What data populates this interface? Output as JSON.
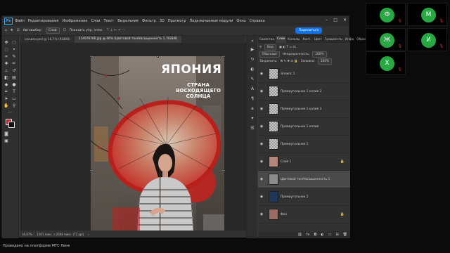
{
  "menubar": {
    "logo": "Ps",
    "items": [
      "Файл",
      "Редактирование",
      "Изображение",
      "Слои",
      "Текст",
      "Выделение",
      "Фильтр",
      "3D",
      "Просмотр",
      "Подключаемые модули",
      "Окно",
      "Справка"
    ]
  },
  "options": {
    "autoselect": "Автовыбор:",
    "layer": "Слой",
    "transform": "Показать упр. элем.",
    "share": "Поделиться"
  },
  "doc": {
    "tab1": "омники.psd @ 16,7% (RGB/8)",
    "tab2": "214970766.jpg @ 46% (Цветовой тон/Насыщенность 1, RGB/8)"
  },
  "artwork": {
    "title": "ЯПОНИЯ",
    "sub1": "СТРАНА",
    "sub2": "ВОСХОДЯЩЕГО",
    "sub3": "СОЛНЦА"
  },
  "status": {
    "zoom": "16,67%",
    "size": "1201 пикс. х 2048 пикс. (72 ppi)"
  },
  "panel": {
    "tabs": [
      "Свойства",
      "Слои",
      "Каналы",
      "Конт.",
      "Цвет",
      "Градиенты",
      "Инфо",
      "Образцы"
    ],
    "active_tab": "Слои",
    "kind": "Вид",
    "blend": "Обычные",
    "opacity_label": "Непрозрачность:",
    "opacity": "100%",
    "lock_label": "Закрепить:",
    "fill_label": "Заливка:",
    "fill": "100%",
    "layers": [
      {
        "name": "Эллипс 1"
      },
      {
        "name": "Прямоугольник 1 копия 2"
      },
      {
        "name": "Прямоугольник 1 копия 3"
      },
      {
        "name": "Прямоугольник 1 копия"
      },
      {
        "name": "Прямоугольник 1"
      },
      {
        "name": "Слой 1"
      },
      {
        "name": "Цветовой тон/Насыщенность 1"
      },
      {
        "name": "Прямоугольник 2"
      },
      {
        "name": "Фон"
      }
    ]
  },
  "participants": [
    {
      "initial": "Ф",
      "color": "#27a843"
    },
    {
      "initial": "М",
      "color": "#27a843"
    },
    {
      "initial": "Ж",
      "color": "#27a843"
    },
    {
      "initial": "И",
      "color": "#27a843"
    },
    {
      "initial": "Х",
      "color": "#27a843"
    }
  ],
  "footer": "Проведено на платформе МТС Линк"
}
